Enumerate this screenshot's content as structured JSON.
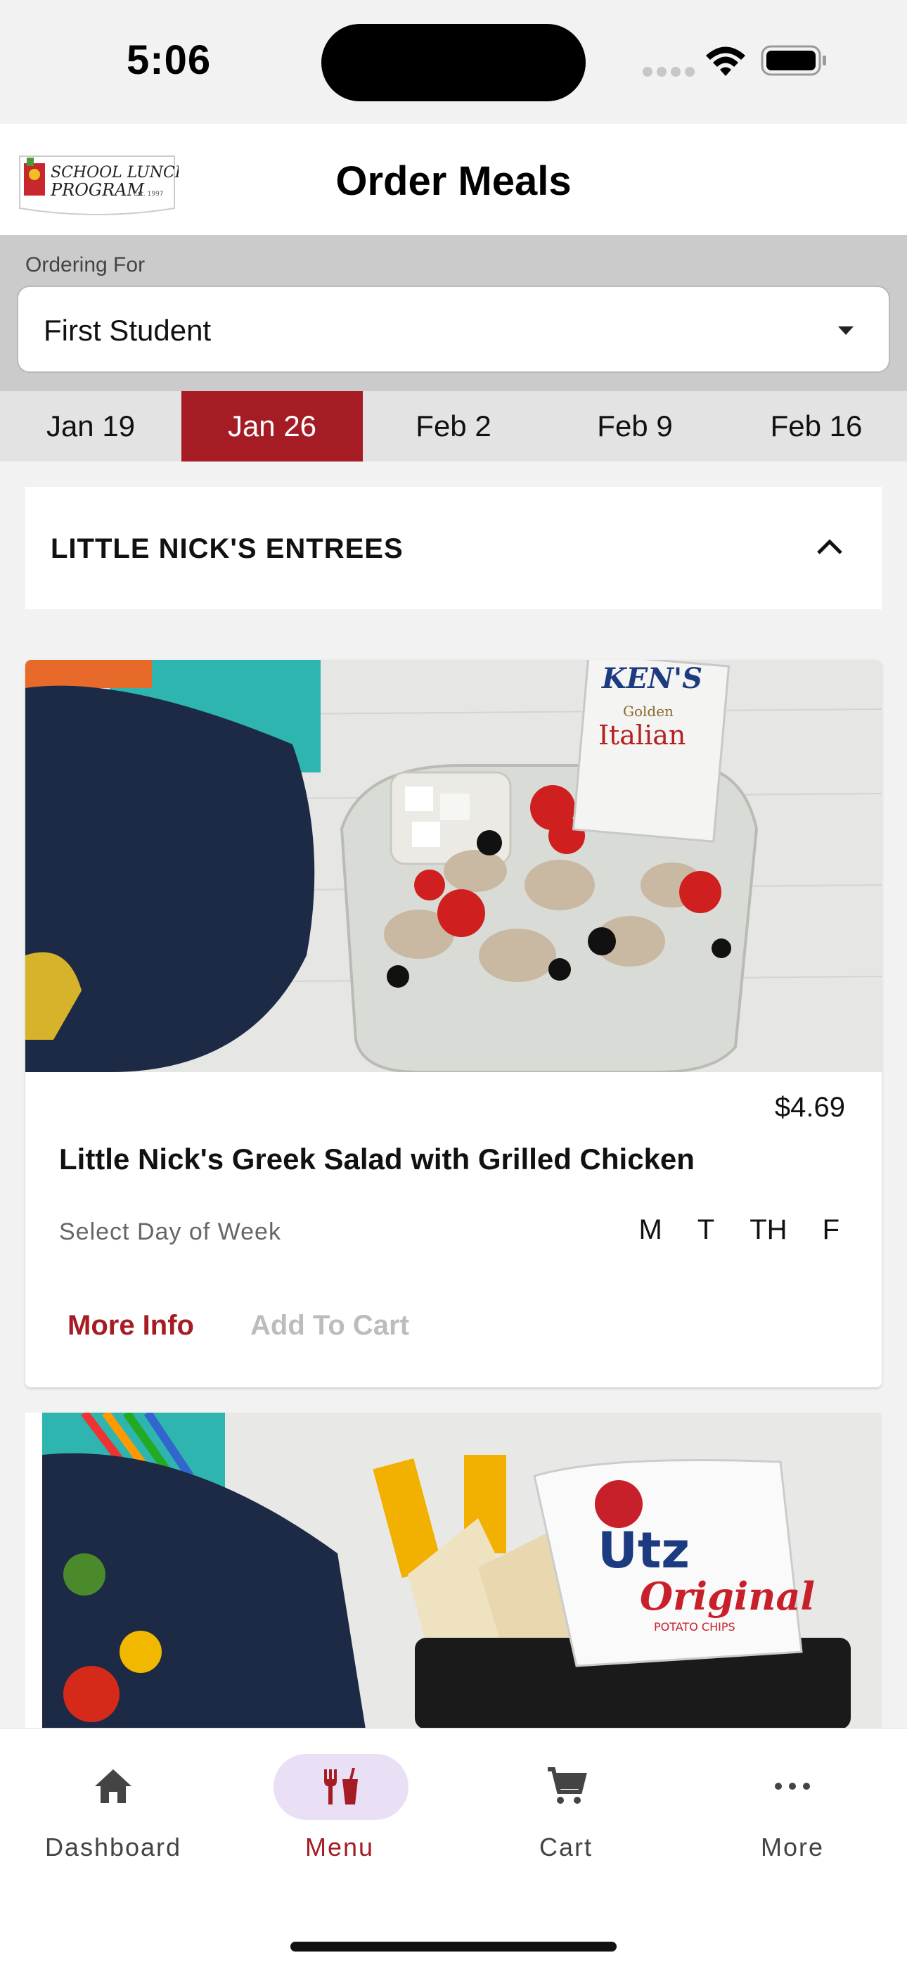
{
  "status_bar": {
    "time": "5:06"
  },
  "header": {
    "title": "Order Meals",
    "logo": {
      "line1": "SCHOOL LUNCH",
      "line2": "PROGRAM",
      "est": "Est. 1997"
    }
  },
  "ordering": {
    "label": "Ordering For",
    "selected": "First Student"
  },
  "weeks": [
    {
      "label": "Jan 19",
      "active": false
    },
    {
      "label": "Jan 26",
      "active": true
    },
    {
      "label": "Feb 2",
      "active": false
    },
    {
      "label": "Feb 9",
      "active": false
    },
    {
      "label": "Feb 16",
      "active": false
    }
  ],
  "category": {
    "title": "LITTLE NICK'S ENTREES"
  },
  "item": {
    "price": "$4.69",
    "name": "Little Nick's Greek Salad with Grilled Chicken",
    "day_label": "Select Day of Week",
    "days": [
      "M",
      "T",
      "TH",
      "F"
    ],
    "more_info": "More Info",
    "add_to_cart": "Add To Cart",
    "packet": {
      "brand": "KEN'S",
      "line1": "Golden",
      "line2": "Italian"
    }
  },
  "item2": {
    "chips_brand": "Utz",
    "chips_flavor": "Original",
    "chips_type": "POTATO CHIPS"
  },
  "tabbar": [
    {
      "label": "Dashboard",
      "icon": "home-icon",
      "active": false
    },
    {
      "label": "Menu",
      "icon": "utensils-icon",
      "active": true
    },
    {
      "label": "Cart",
      "icon": "cart-icon",
      "active": false
    },
    {
      "label": "More",
      "icon": "more-icon",
      "active": false
    }
  ],
  "colors": {
    "brand_red": "#a61c24",
    "active_pill": "#eae0f6"
  }
}
